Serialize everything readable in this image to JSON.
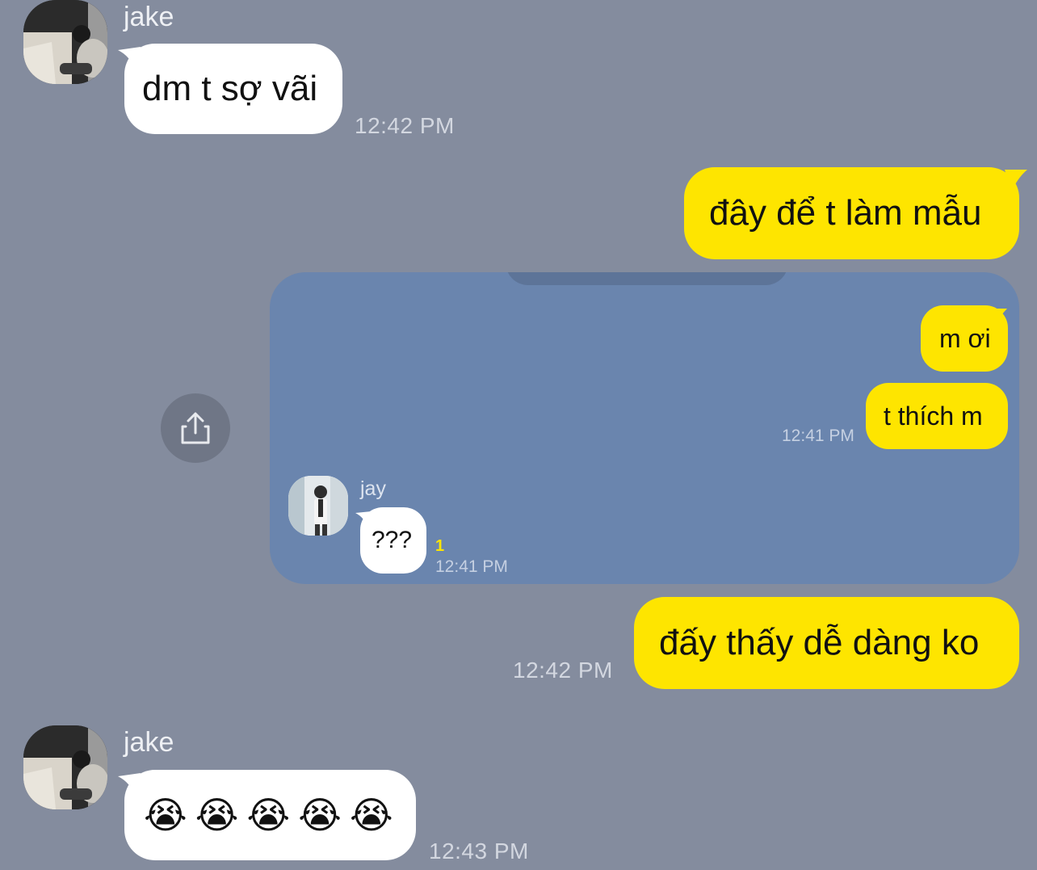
{
  "messages": {
    "m1": {
      "sender": "jake",
      "text": "dm t sợ vãi",
      "time": "12:42 PM"
    },
    "m2": {
      "text": "đây để t làm mẫu"
    },
    "m3": {
      "shared": {
        "msg1": "m ơi",
        "msg2": "t thích m",
        "msg2_time": "12:41 PM",
        "reply_sender": "jay",
        "reply_text": "???",
        "unread_count": "1",
        "reply_time": "12:41 PM"
      }
    },
    "m4": {
      "text": "đấy thấy dễ dàng ko",
      "time": "12:42 PM"
    },
    "m5": {
      "sender": "jake",
      "emojis": [
        "😭",
        "😭",
        "😭",
        "😭",
        "😭"
      ],
      "time": "12:43 PM"
    }
  },
  "icons": {
    "share": "share-upload-icon"
  },
  "colors": {
    "background": "#848c9e",
    "outgoing_bubble": "#fee500",
    "incoming_bubble": "#ffffff",
    "shared_card": "#6a85ae"
  }
}
